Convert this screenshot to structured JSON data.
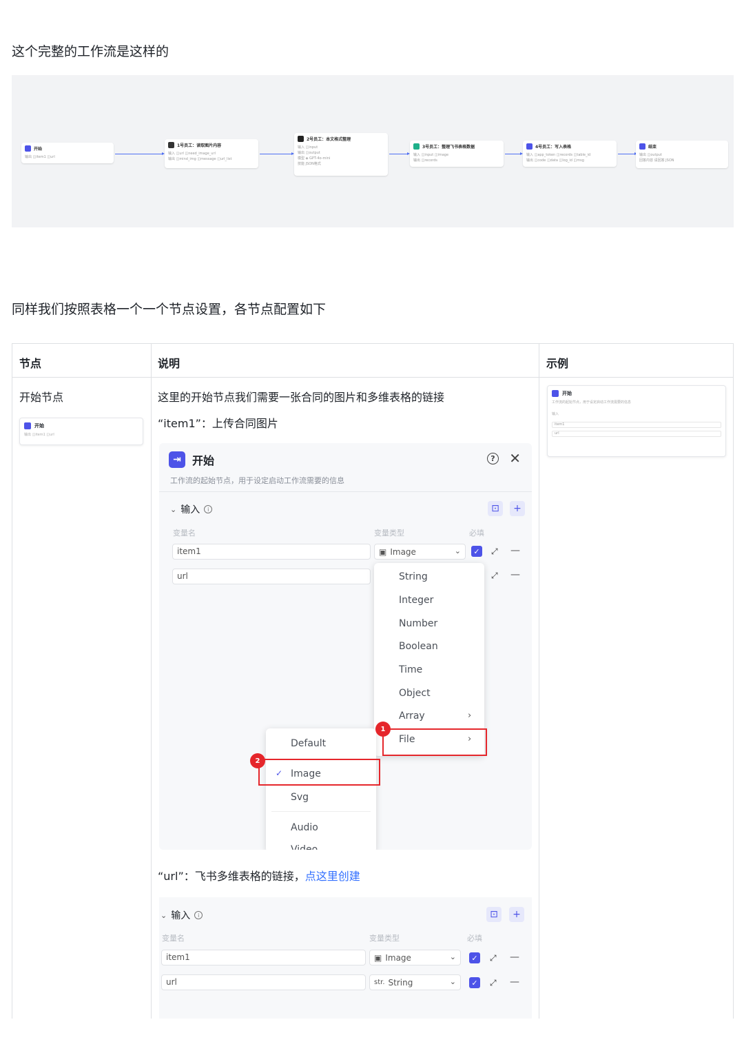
{
  "intro": "这个完整的工作流是这样的",
  "workflow": {
    "nodes": [
      {
        "title": "开始",
        "row1": "输出  ◫item1  ◫url",
        "color": "#4d53e8"
      },
      {
        "title": "1号员工：读取图片内容",
        "row1": "输入  ◫url  ◫need_image_url",
        "row2": "输出  ◫mind_img  ◫message  ◫url_list",
        "color": "#333333"
      },
      {
        "title": "2号员工：本文格式整理",
        "row1": "输入  ◫input",
        "row2": "输出  ◫output",
        "row3": "模型  ◈ GPT-4o-mini",
        "row4": "技能  JSON格式",
        "color": "#222222"
      },
      {
        "title": "3号员工：整理飞书表格数据",
        "row1": "输入  ◫input  ◫image",
        "row2": "输出  ◫records",
        "color": "#1fb08a"
      },
      {
        "title": "4号员工：写入表格",
        "row1": "输入  ◫app_token  ◫records  ◫table_id",
        "row2": "输出  ◫code  ◫data  ◫log_id  ◫msg",
        "color": "#4d53e8"
      },
      {
        "title": "结束",
        "row1": "输出  ◫output",
        "row2": "回答内容  请回答 JSON",
        "color": "#4d53e8"
      }
    ]
  },
  "section_title": "同样我们按照表格一个一个节点设置，各节点配置如下",
  "table": {
    "headers": [
      "节点",
      "说明",
      "示例"
    ],
    "row1": {
      "node": "开始节点",
      "desc1": "这里的开始节点我们需要一张合同的图片和多维表格的链接",
      "desc2": "“item1”：上传合同图片",
      "desc3_prefix": "“url”：飞书多维表格的链接，",
      "desc3_link": "点这里创建"
    }
  },
  "panel": {
    "title": "开始",
    "subtitle": "工作流的起始节点，用于设定启动工作流需要的信息",
    "section": "输入",
    "col_name": "变量名",
    "col_type": "变量类型",
    "col_required": "必填",
    "rows": [
      {
        "name": "item1",
        "type": "Image"
      },
      {
        "name": "url",
        "type": ""
      }
    ],
    "type_menu": [
      "String",
      "Integer",
      "Number",
      "Boolean",
      "Time",
      "Object",
      "Array",
      "File"
    ],
    "file_menu": [
      "Default",
      "Image",
      "Svg",
      "Audio",
      "Video"
    ],
    "badge1": "1",
    "badge2": "2"
  },
  "panel2": {
    "section": "输入",
    "col_name": "变量名",
    "col_type": "变量类型",
    "col_required": "必填",
    "rows": [
      {
        "name": "item1",
        "type": "Image"
      },
      {
        "name": "url",
        "type": "String"
      }
    ]
  },
  "thumb": {
    "title": "开始",
    "row": "输出  ◫item1  ◫url",
    "example_title": "开始",
    "example_sub": "工作流的起始节点，用于设定启动工作流需要的信息",
    "example_section": "输入",
    "example_rows": [
      "item1",
      "url"
    ]
  },
  "colors": {
    "accent": "#4d53e8",
    "link": "#3370ff",
    "highlight": "#e5262b"
  }
}
